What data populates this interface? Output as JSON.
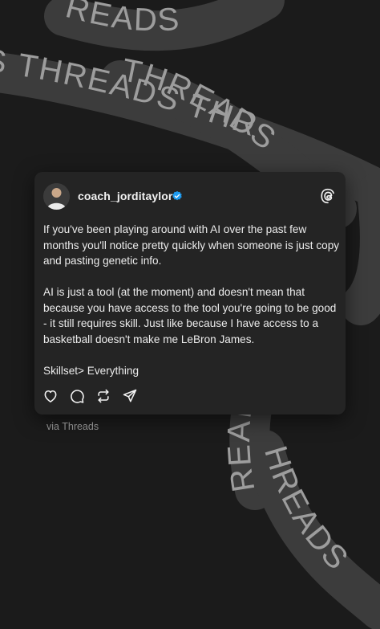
{
  "background": {
    "ribbon_text_1": "S THREADS THR",
    "ribbon_text_2": "READS",
    "ribbon_text_3": "THREADS",
    "ribbon_text_4": "READS",
    "ribbon_text_5": "HREADS"
  },
  "post": {
    "username": "coach_jorditaylor",
    "verified": true,
    "paragraphs": [
      "If you've been playing around with AI over the past few months you'll notice pretty quickly when someone is just copy and pasting genetic info.",
      "AI is just a tool (at the moment) and doesn't mean that because you have access to the tool you're going to be good - it still requires skill. Just like because I have access to a basketball doesn't make me LeBron James.",
      "Skillset> Everything"
    ],
    "actions": [
      "heart-icon",
      "comment-icon",
      "repost-icon",
      "share-icon"
    ]
  },
  "footer": {
    "via": "via Threads"
  },
  "colors": {
    "background": "#1b1b1b",
    "card": "#242424",
    "ribbon": "#3a3a3a",
    "verified": "#1d9bf0"
  }
}
